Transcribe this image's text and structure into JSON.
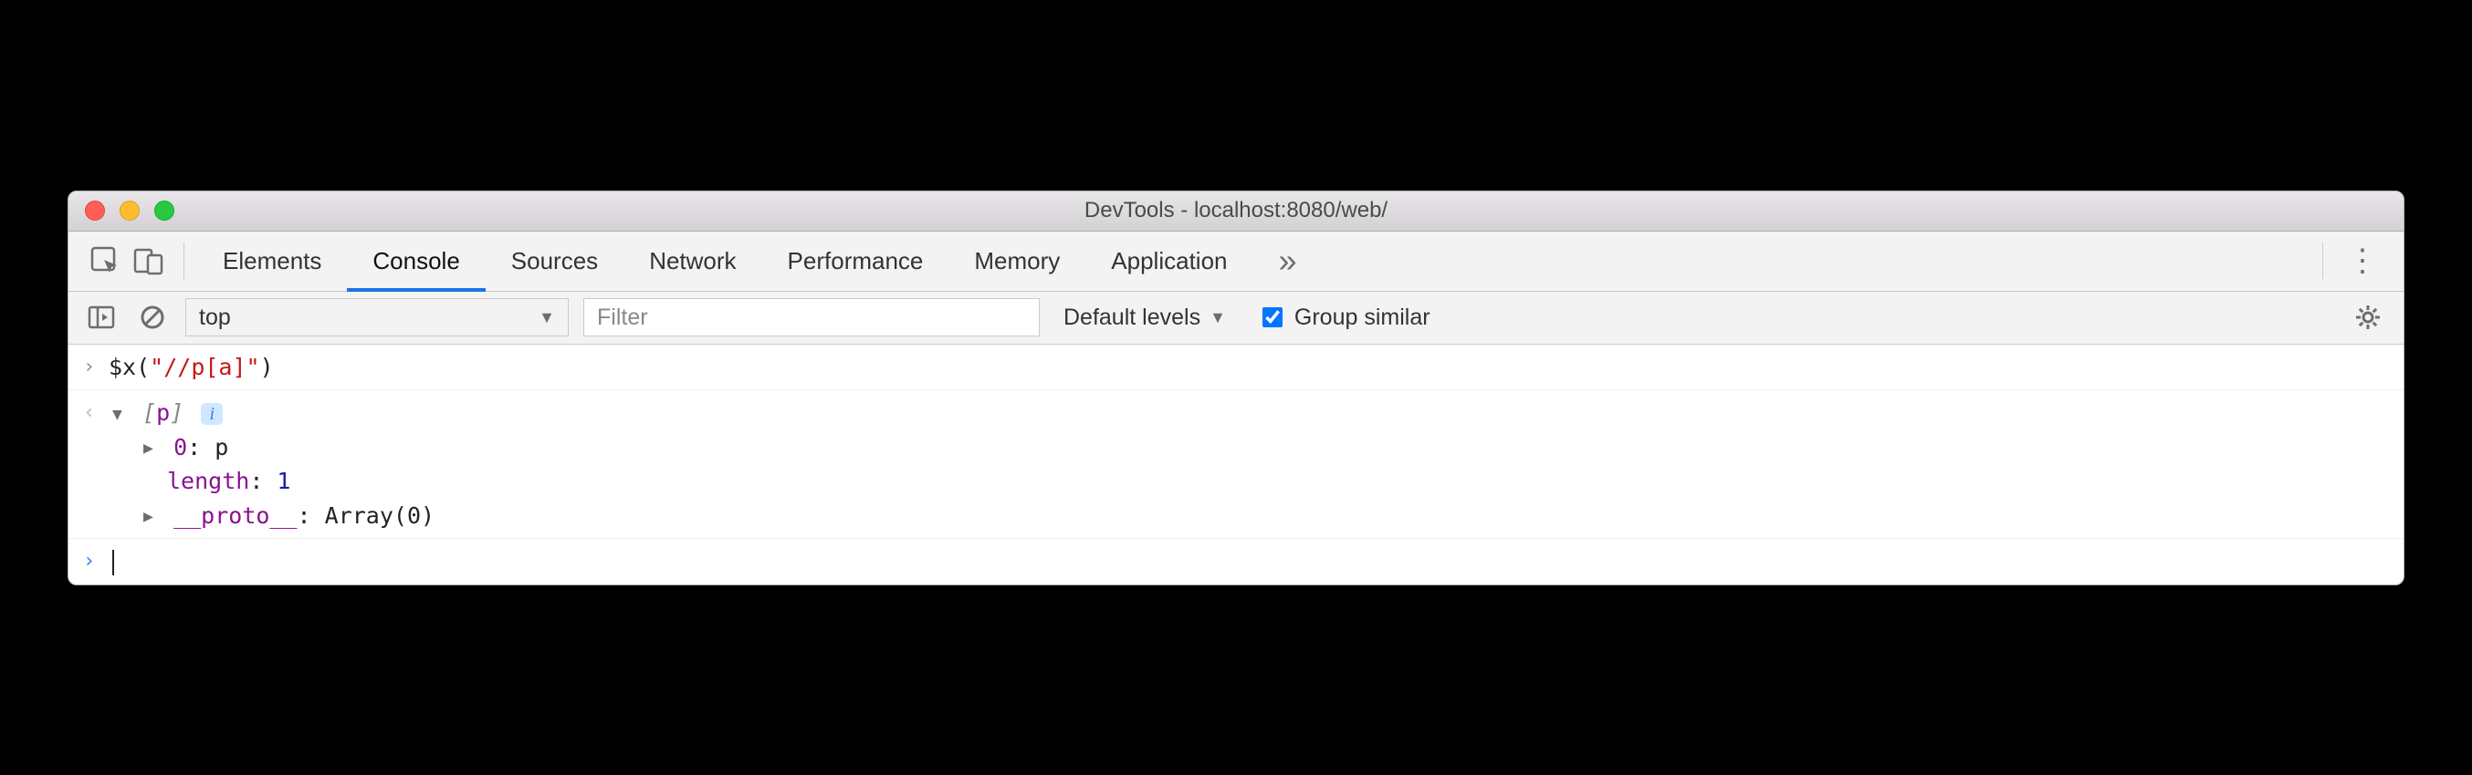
{
  "window": {
    "title": "DevTools - localhost:8080/web/"
  },
  "tabs": {
    "items": [
      {
        "label": "Elements",
        "active": false
      },
      {
        "label": "Console",
        "active": true
      },
      {
        "label": "Sources",
        "active": false
      },
      {
        "label": "Network",
        "active": false
      },
      {
        "label": "Performance",
        "active": false
      },
      {
        "label": "Memory",
        "active": false
      },
      {
        "label": "Application",
        "active": false
      }
    ],
    "overflow_glyph": "»"
  },
  "toolbar": {
    "context_label": "top",
    "filter_placeholder": "Filter",
    "levels_label": "Default levels",
    "group_similar_label": "Group similar",
    "group_similar_checked": true
  },
  "console": {
    "input_fn": "$x",
    "input_arg": "\"//p[a]\"",
    "result": {
      "summary_tokens": [
        "[",
        "p",
        "]"
      ],
      "rows": [
        {
          "key": "0",
          "value": "p",
          "expandable": true
        },
        {
          "key": "length",
          "value": "1",
          "expandable": false
        },
        {
          "key": "__proto__",
          "value": "Array(0)",
          "expandable": true
        }
      ]
    }
  }
}
